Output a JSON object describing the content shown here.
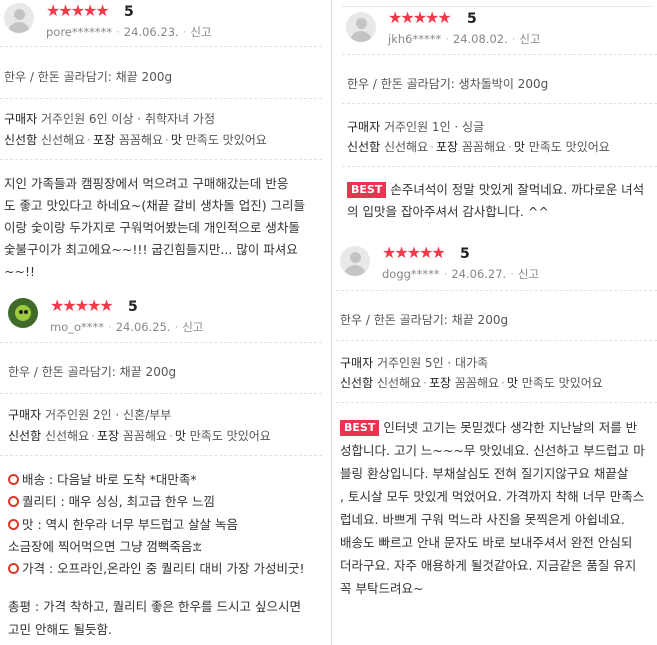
{
  "reviews": {
    "r1": {
      "stars": "★★★★★",
      "score": "5",
      "user": "pore*******",
      "date": "24.06.23.",
      "report": "신고",
      "option": "한우 / 한돈 골라담기: 채끝 200g",
      "buyer_label": "구매자",
      "buyer_info": "거주인원 6인 이상 · 취학자녀 가정",
      "tags": [
        {
          "key": "신선함",
          "value": "신선해요"
        },
        {
          "key": "포장",
          "value": "꼼꼼해요"
        },
        {
          "key": "맛",
          "value": "만족도 맛있어요"
        }
      ],
      "body_lines": [
        "지인 가족들과 캠핑장에서 먹으려고 구매해갔는데   반응",
        "도 좋고 맛있다고 하네요~(채끝 갈비 생차돌 업진) 그리들",
        "이랑 숯이랑 두가지로 구워먹어봤는데 개인적으로 생차돌",
        "숯불구이가 최고에요~~!!! 굽긴힘들지만...     많이 파셔요",
        "~~!!"
      ]
    },
    "r2": {
      "stars": "★★★★★",
      "score": "5",
      "user": "mo_o****",
      "date": "24.06.25.",
      "report": "신고",
      "option": "한우 / 한돈 골라담기: 채끝 200g",
      "buyer_label": "구매자",
      "buyer_info": "거주인원 2인 · 신혼/부부",
      "tags": [
        {
          "key": "신선함",
          "value": "신선해요"
        },
        {
          "key": "포장",
          "value": "꼼꼼해요"
        },
        {
          "key": "맛",
          "value": "만족도 맛있어요"
        }
      ],
      "body_lines": [
        {
          "bullet": true,
          "text": "배송 : 다음날 바로 도착 *대만족*"
        },
        {
          "bullet": true,
          "text": "퀄리티 : 매우 싱싱, 최고급 한우 느낌"
        },
        {
          "bullet": true,
          "text": "맛 : 역시 한우라 너무 부드럽고 살살 녹음"
        },
        {
          "bullet": false,
          "text": "소금장에 찍어먹으면 그냥 껌뻑죽음𖠊"
        },
        {
          "bullet": true,
          "text": "가격 : 오프라인,온라인 중 퀄리티 대비 가장 가성비굿!"
        },
        {
          "bullet": false,
          "text": ""
        },
        {
          "bullet": false,
          "text": "총평 : 가격 착하고, 퀄리티 좋은 한우를 드시고 싶으시면"
        },
        {
          "bullet": false,
          "text": "고민 안해도 될듯함."
        }
      ]
    },
    "r3": {
      "stars": "★★★★★",
      "score": "5",
      "user": "jkh6*****",
      "date": "24.08.02.",
      "report": "신고",
      "option": "한우 / 한돈 골라담기: 생차돌박이 200g",
      "buyer_label": "구매자",
      "buyer_info": "거주인원 1인 · 싱글",
      "tags": [
        {
          "key": "신선함",
          "value": "신선해요"
        },
        {
          "key": "포장",
          "value": "꼼꼼해요"
        },
        {
          "key": "맛",
          "value": "만족도 맛있어요"
        }
      ],
      "badge": "BEST",
      "body_lines": [
        "손주녀석이 정말 맛있게 잘먹네요. 까다로운 녀석",
        "의 입맛을 잡아주셔서 감사합니다. ^^"
      ]
    },
    "r4": {
      "stars": "★★★★★",
      "score": "5",
      "user": "dogg*****",
      "date": "24.06.27.",
      "report": "신고",
      "option": "한우 / 한돈 골라담기: 채끝 200g",
      "buyer_label": "구매자",
      "buyer_info": "거주인원 5인 · 대가족",
      "tags": [
        {
          "key": "신선함",
          "value": "신선해요"
        },
        {
          "key": "포장",
          "value": "꼼꼼해요"
        },
        {
          "key": "맛",
          "value": "만족도 맛있어요"
        }
      ],
      "badge": "BEST",
      "body_lines": [
        "인터넷 고기는 못믿겠다 생각한 지난날의 저를 반",
        "성합니다. 고기 느~~~무 맛있네요. 신선하고 부드럽고 마",
        "블링 환상입니다. 부채살심도 전혀 질기지않구요 채끝살",
        ", 토시살 모두 맛있게 먹었어요. 가격까지 착해 너무 만족스",
        "럽네요. 바쁘게 구워 먹느라 사진을 못찍은게 아쉽네요.",
        "배송도 빠르고 안내 문자도 바로 보내주셔서 완전 안심되",
        "더라구요. 자주 애용하게 될것같아요. 지금같은 품질 유지",
        "꼭 부탁드려요~"
      ]
    }
  },
  "colors": {
    "star": "#f33a4a",
    "best_badge": "#e8344e",
    "bullet_ring": "#d63a2c"
  }
}
